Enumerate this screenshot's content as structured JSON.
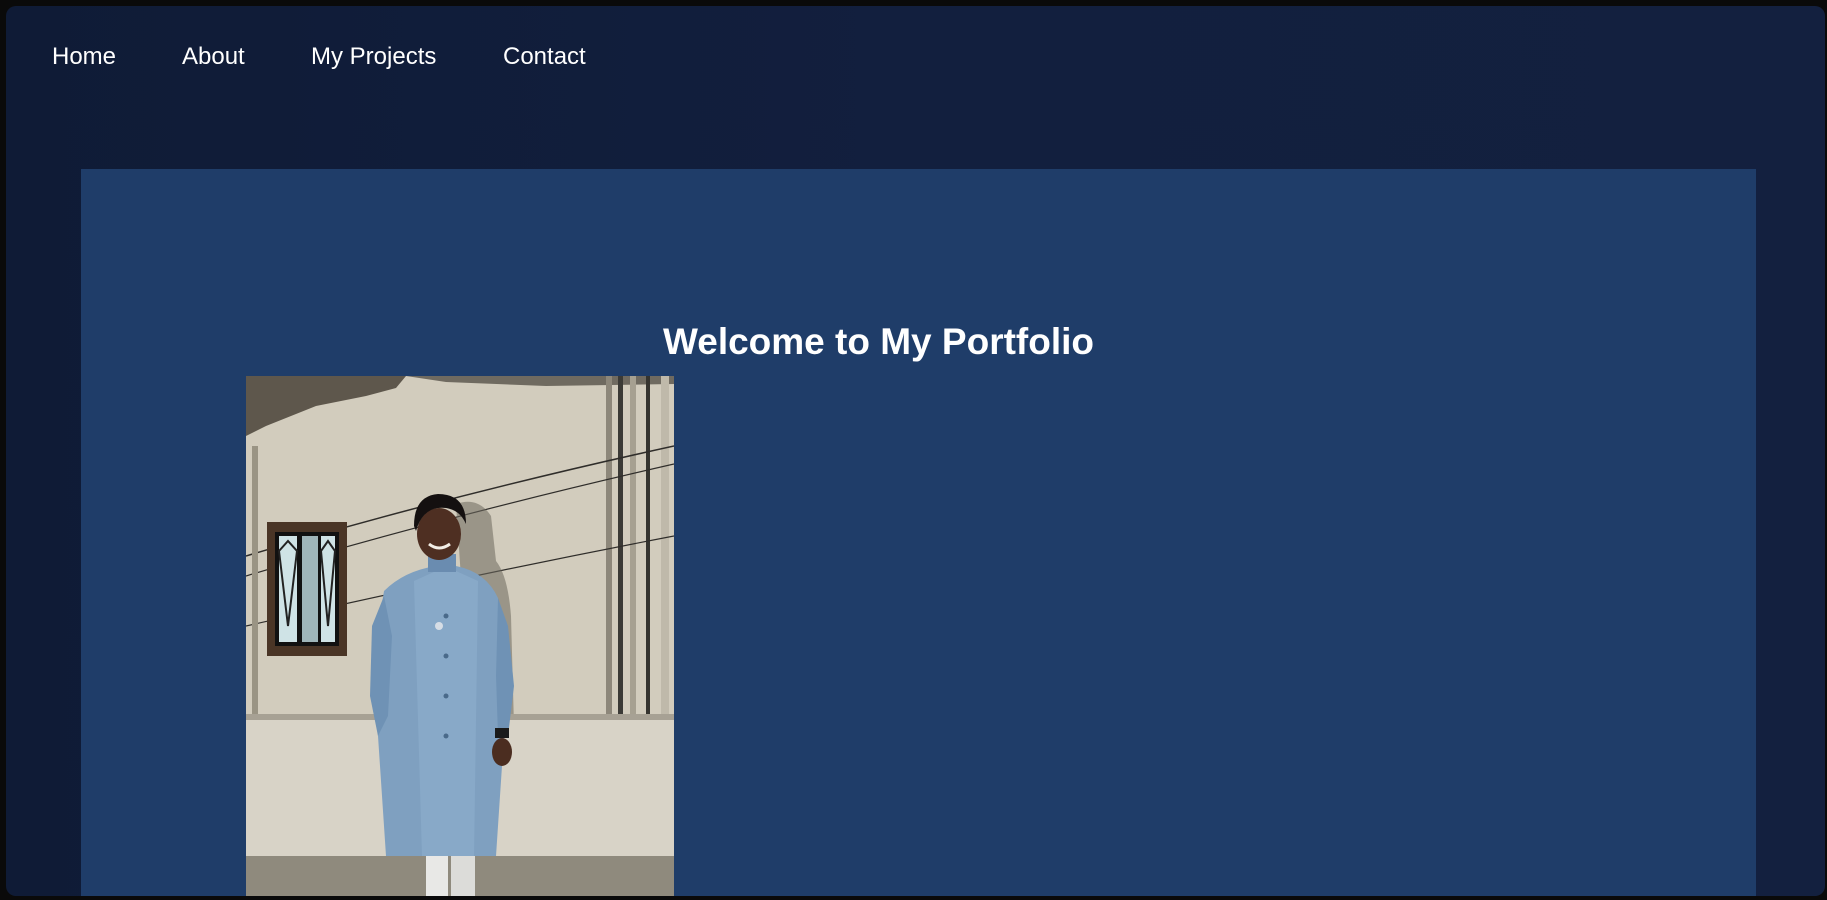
{
  "nav": {
    "items": [
      {
        "label": "Home"
      },
      {
        "label": "About"
      },
      {
        "label": "My Projects"
      },
      {
        "label": "Contact"
      }
    ]
  },
  "hero": {
    "title": "Welcome to My Portfolio",
    "photo_alt": "portrait-photo"
  },
  "colors": {
    "page_background": "#121f3e",
    "hero_background": "#1f3d69",
    "text": "#ffffff"
  }
}
